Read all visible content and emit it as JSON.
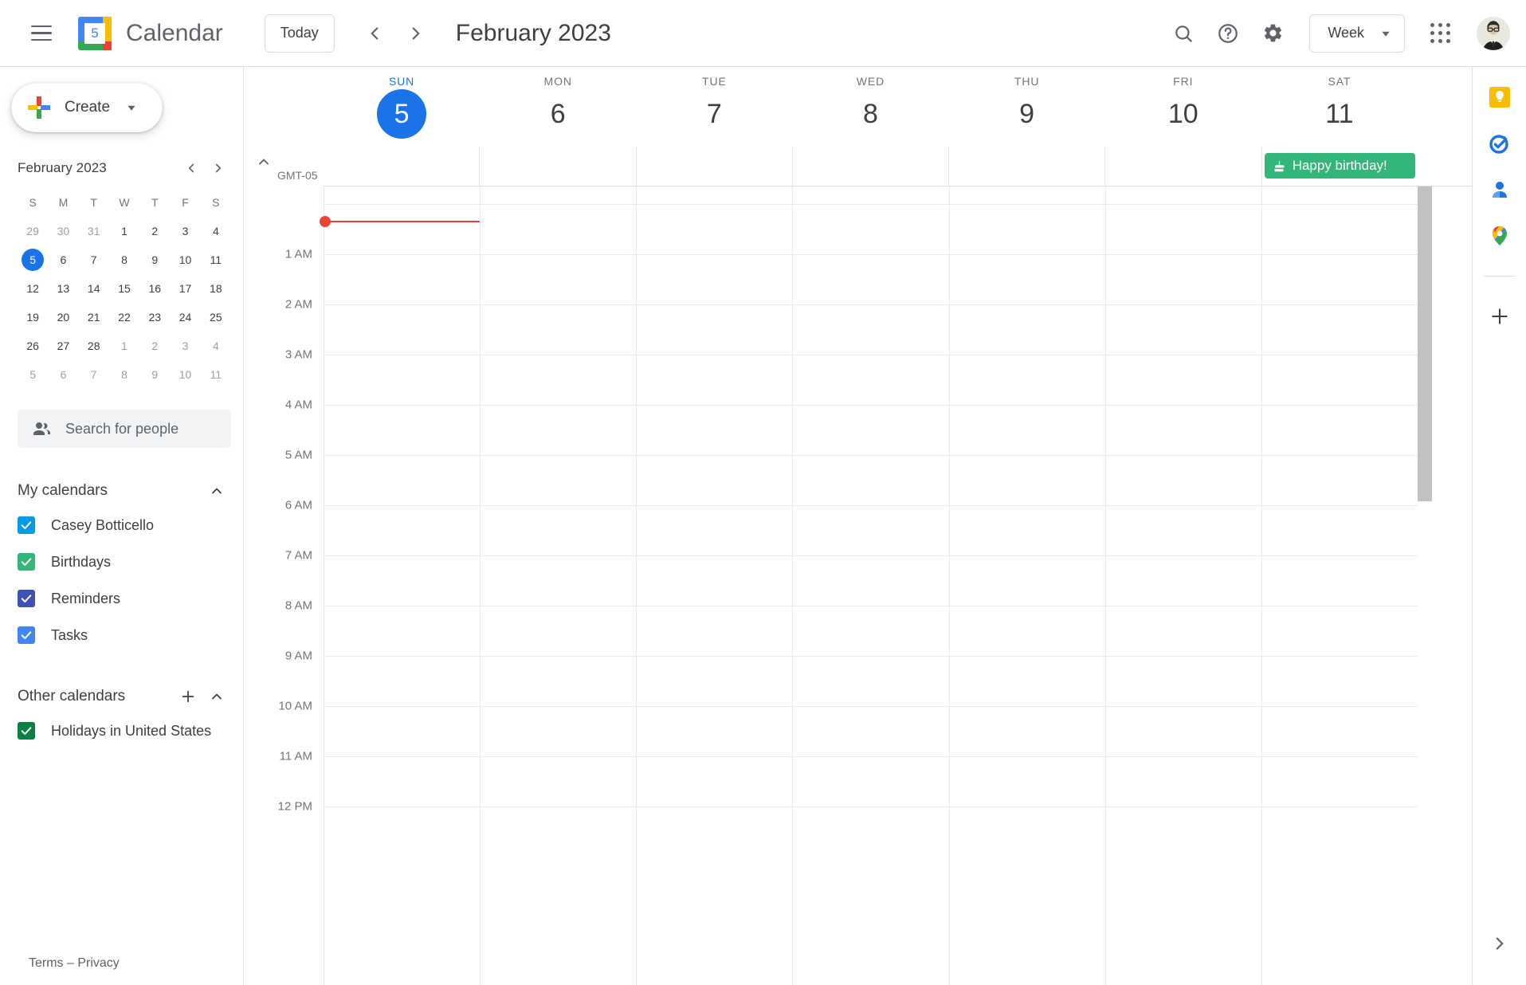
{
  "header": {
    "menu_label": "Main menu",
    "logo_day": "5",
    "app_title": "Calendar",
    "today_label": "Today",
    "prev_label": "Previous week",
    "next_label": "Next week",
    "period_title": "February 2023",
    "search_label": "Search",
    "help_label": "Support",
    "settings_label": "Settings",
    "view_label": "Week",
    "apps_label": "Google apps",
    "avatar_label": "Google Account"
  },
  "sidebar": {
    "create_label": "Create",
    "mini_calendar": {
      "title": "February 2023",
      "weekday_headers": [
        "S",
        "M",
        "T",
        "W",
        "T",
        "F",
        "S"
      ],
      "weeks": [
        [
          {
            "d": "29",
            "out": true
          },
          {
            "d": "30",
            "out": true
          },
          {
            "d": "31",
            "out": true
          },
          {
            "d": "1",
            "out": false
          },
          {
            "d": "2",
            "out": false
          },
          {
            "d": "3",
            "out": false
          },
          {
            "d": "4",
            "out": false
          }
        ],
        [
          {
            "d": "5",
            "out": false,
            "today": true
          },
          {
            "d": "6",
            "out": false
          },
          {
            "d": "7",
            "out": false
          },
          {
            "d": "8",
            "out": false
          },
          {
            "d": "9",
            "out": false
          },
          {
            "d": "10",
            "out": false
          },
          {
            "d": "11",
            "out": false
          }
        ],
        [
          {
            "d": "12",
            "out": false
          },
          {
            "d": "13",
            "out": false
          },
          {
            "d": "14",
            "out": false
          },
          {
            "d": "15",
            "out": false
          },
          {
            "d": "16",
            "out": false
          },
          {
            "d": "17",
            "out": false
          },
          {
            "d": "18",
            "out": false
          }
        ],
        [
          {
            "d": "19",
            "out": false
          },
          {
            "d": "20",
            "out": false
          },
          {
            "d": "21",
            "out": false
          },
          {
            "d": "22",
            "out": false
          },
          {
            "d": "23",
            "out": false
          },
          {
            "d": "24",
            "out": false
          },
          {
            "d": "25",
            "out": false
          }
        ],
        [
          {
            "d": "26",
            "out": false
          },
          {
            "d": "27",
            "out": false
          },
          {
            "d": "28",
            "out": false
          },
          {
            "d": "1",
            "out": true
          },
          {
            "d": "2",
            "out": true
          },
          {
            "d": "3",
            "out": true
          },
          {
            "d": "4",
            "out": true
          }
        ],
        [
          {
            "d": "5",
            "out": true
          },
          {
            "d": "6",
            "out": true
          },
          {
            "d": "7",
            "out": true
          },
          {
            "d": "8",
            "out": true
          },
          {
            "d": "9",
            "out": true
          },
          {
            "d": "10",
            "out": true
          },
          {
            "d": "11",
            "out": true
          }
        ]
      ]
    },
    "people_search_placeholder": "Search for people",
    "my_calendars": {
      "title": "My calendars",
      "items": [
        {
          "label": "Casey Botticello",
          "color": "#039BE5",
          "checked": true
        },
        {
          "label": "Birthdays",
          "color": "#33B679",
          "checked": true
        },
        {
          "label": "Reminders",
          "color": "#3F51B5",
          "checked": true
        },
        {
          "label": "Tasks",
          "color": "#4285F4",
          "checked": true
        }
      ]
    },
    "other_calendars": {
      "title": "Other calendars",
      "add_label": "Add other calendars",
      "items": [
        {
          "label": "Holidays in United States",
          "color": "#0B8043",
          "checked": true
        }
      ]
    },
    "footer": "Terms – Privacy"
  },
  "grid": {
    "timezone_label": "GMT-05",
    "days": [
      {
        "dow": "SUN",
        "num": "5",
        "today": true
      },
      {
        "dow": "MON",
        "num": "6",
        "today": false
      },
      {
        "dow": "TUE",
        "num": "7",
        "today": false
      },
      {
        "dow": "WED",
        "num": "8",
        "today": false
      },
      {
        "dow": "THU",
        "num": "9",
        "today": false
      },
      {
        "dow": "FRI",
        "num": "10",
        "today": false
      },
      {
        "dow": "SAT",
        "num": "11",
        "today": false
      }
    ],
    "hour_labels": [
      "1 AM",
      "2 AM",
      "3 AM",
      "4 AM",
      "5 AM",
      "6 AM",
      "7 AM",
      "8 AM",
      "9 AM",
      "10 AM",
      "11 AM",
      "12 PM"
    ],
    "all_day_events": [
      {
        "day_index": 6,
        "title": "Happy birthday!",
        "color": "#33B679",
        "icon": "cake-icon"
      }
    ],
    "current_time_color": "#EA4335"
  },
  "right_rail": {
    "items": [
      {
        "name": "google-keep-icon",
        "label": "Keep"
      },
      {
        "name": "google-tasks-icon",
        "label": "Tasks"
      },
      {
        "name": "google-contacts-icon",
        "label": "Contacts"
      },
      {
        "name": "google-maps-icon",
        "label": "Maps"
      }
    ],
    "add_label": "Get add-ons",
    "expand_label": "Show side panel"
  }
}
